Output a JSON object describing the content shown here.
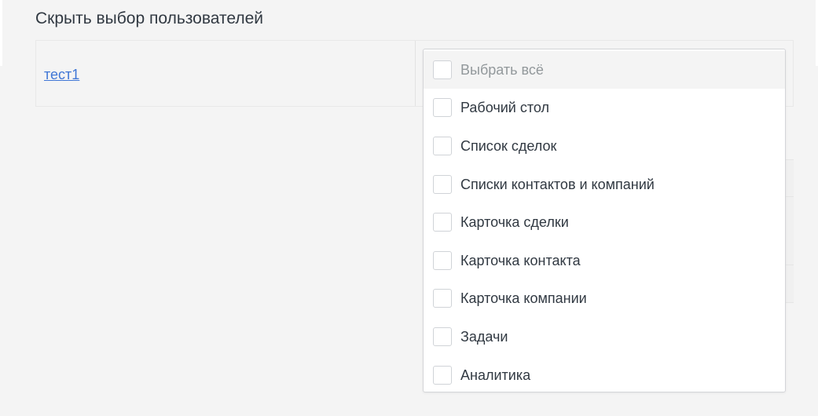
{
  "section": {
    "title": "Скрыть выбор пользователей"
  },
  "user_row": {
    "name": "тест1"
  },
  "dropdown": {
    "select_all": "Выбрать всё",
    "options": [
      "Рабочий стол",
      "Список сделок",
      "Списки контактов и компаний",
      "Карточка сделки",
      "Карточка контакта",
      "Карточка компании",
      "Задачи",
      "Аналитика"
    ]
  },
  "colors": {
    "link": "#4077d6",
    "text": "#313942",
    "muted": "#92989b",
    "panel_bg": "#f4f4f4"
  }
}
